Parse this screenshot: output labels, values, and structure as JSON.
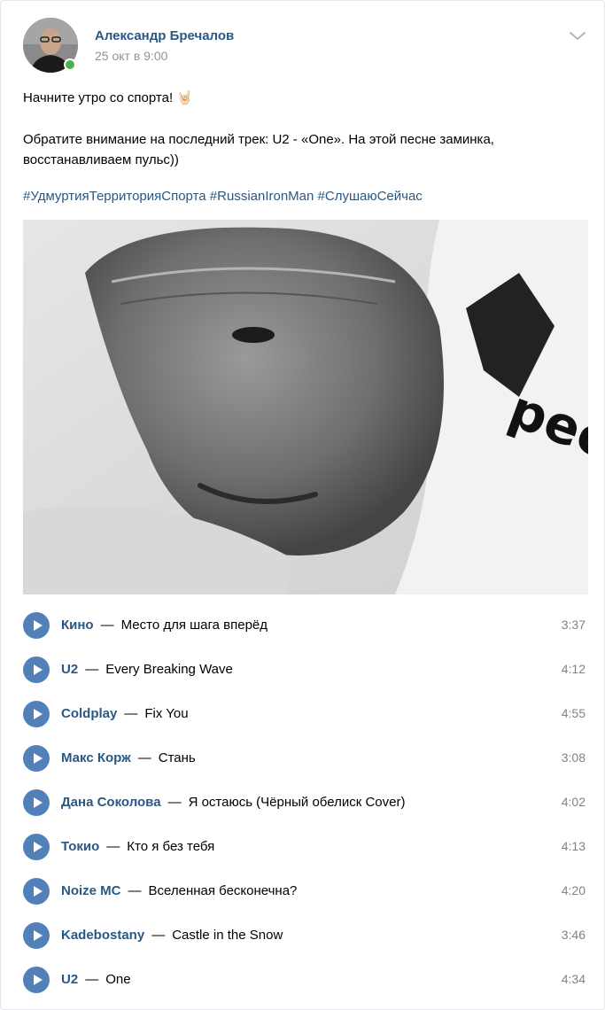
{
  "post": {
    "author": "Александр Бречалов",
    "date": "25 окт в 9:00",
    "text_line1": "Начните утро со спорта! 🤘🏻",
    "text_line2": "Обратите внимание на последний трек: U2 - «One». На этой песне заминка, восстанавливаем пульс))",
    "hashtags": [
      "#УдмуртияТерриторияСпорта",
      "#RussianIronMan",
      "#СлушаюСейчас"
    ],
    "photo_text": "pec"
  },
  "tracks": [
    {
      "artist": "Кино",
      "title": "Место для шага вперёд",
      "duration": "3:37"
    },
    {
      "artist": "U2",
      "title": "Every Breaking Wave",
      "duration": "4:12"
    },
    {
      "artist": "Coldplay",
      "title": "Fix You",
      "duration": "4:55"
    },
    {
      "artist": "Макс Корж",
      "title": "Стань",
      "duration": "3:08"
    },
    {
      "artist": "Дана Соколова",
      "title": "Я остаюсь (Чёрный обелиск Cover)",
      "duration": "4:02"
    },
    {
      "artist": "Токио",
      "title": "Кто я без тебя",
      "duration": "4:13"
    },
    {
      "artist": "Noize MC",
      "title": "Вселенная бесконечна?",
      "duration": "4:20"
    },
    {
      "artist": "Kadebostany",
      "title": "Castle in the Snow",
      "duration": "3:46"
    },
    {
      "artist": "U2",
      "title": "One",
      "duration": "4:34"
    }
  ],
  "colors": {
    "link": "#2a5885",
    "play": "#5181b8",
    "online": "#4bb34b",
    "muted": "#939393"
  },
  "icons": {
    "menu": "chevron-down-icon",
    "play": "play-icon"
  },
  "separator": "—"
}
